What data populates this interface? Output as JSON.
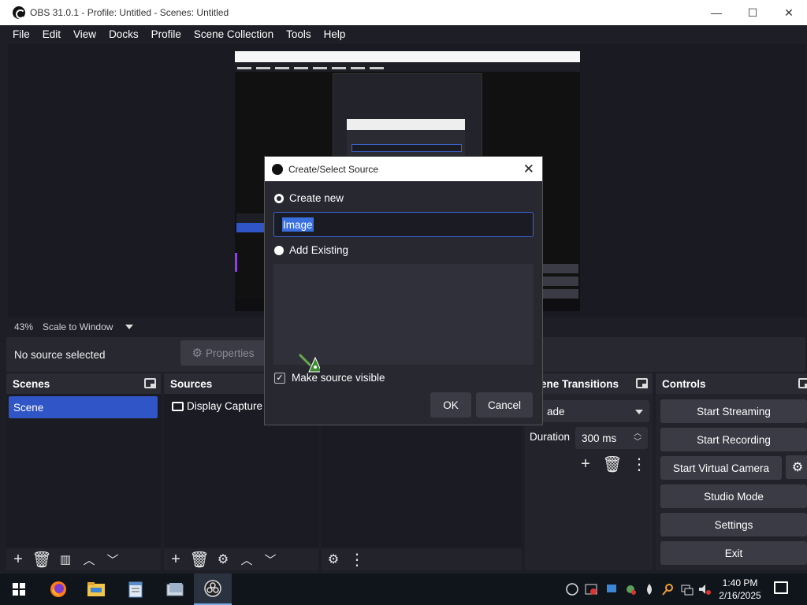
{
  "window": {
    "title": "OBS 31.0.1 - Profile: Untitled - Scenes: Untitled",
    "minimize": "—",
    "maximize": "☐",
    "close": "✕"
  },
  "menu": [
    "File",
    "Edit",
    "View",
    "Docks",
    "Profile",
    "Scene Collection",
    "Tools",
    "Help"
  ],
  "preview_bar": {
    "zoom": "43%",
    "scale_mode": "Scale to Window"
  },
  "source_bar": {
    "status": "No source selected",
    "properties_label": "Properties"
  },
  "docks": {
    "scenes": {
      "title": "Scenes",
      "items": [
        "Scene"
      ],
      "selected": "Scene"
    },
    "sources": {
      "title": "Sources",
      "items": [
        "Display Capture"
      ]
    },
    "transitions": {
      "title": "Scene Transitions",
      "title_visible": "ene Transitions",
      "transition": "Fade",
      "transition_visible": "ade",
      "duration_label": "Duration",
      "duration_value": "300 ms"
    },
    "controls": {
      "title": "Controls",
      "buttons": [
        "Start Streaming",
        "Start Recording",
        "Start Virtual Camera",
        "Studio Mode",
        "Settings",
        "Exit"
      ]
    }
  },
  "dialog": {
    "title": "Create/Select Source",
    "create_new_label": "Create new",
    "name_value": "Image",
    "add_existing_label": "Add Existing",
    "make_visible_label": "Make source visible",
    "make_visible_checked": true,
    "ok_label": "OK",
    "cancel_label": "Cancel"
  },
  "taskbar": {
    "time": "1:40 PM",
    "date": "2/16/2025",
    "apps": [
      "firefox-icon",
      "file-explorer-icon",
      "notepad-icon",
      "photos-icon",
      "obs-icon"
    ]
  },
  "colors": {
    "accent": "#2f55c6",
    "background": "#1e1f26",
    "panel": "#22232b",
    "button": "#3a3b45"
  }
}
